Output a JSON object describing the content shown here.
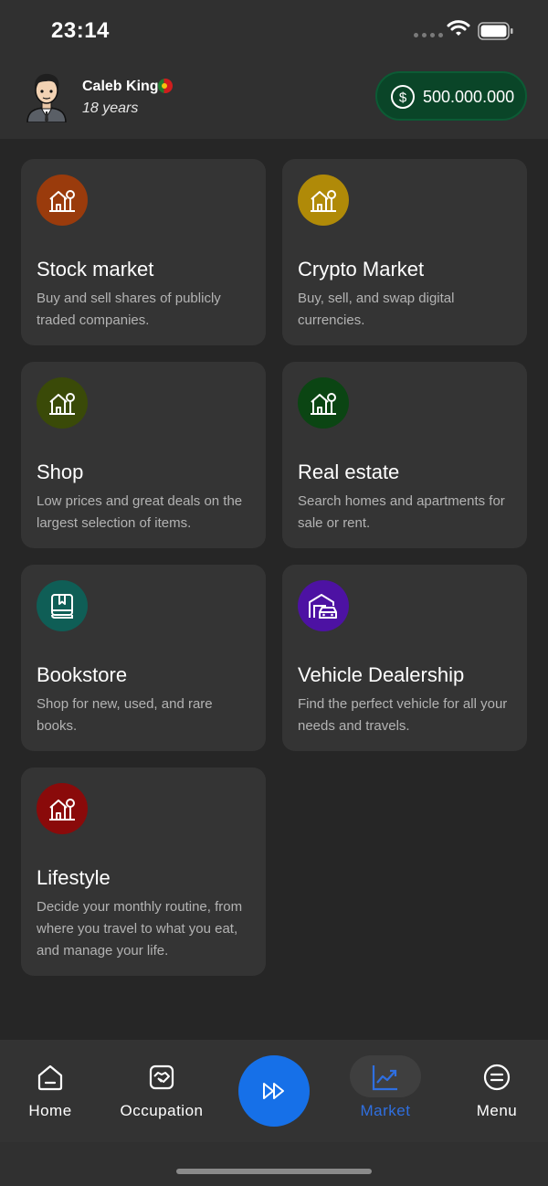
{
  "status_bar": {
    "time": "23:14",
    "icons": [
      "signal-dots-icon",
      "wifi-icon",
      "battery-icon"
    ]
  },
  "profile": {
    "name": "Caleb King",
    "age": "18 years",
    "flag": "portugal-flag-icon",
    "avatar": "avatar-icon"
  },
  "wallet": {
    "balance": "500.000.000",
    "icon": "dollar-coin-icon"
  },
  "cards": [
    {
      "title": "Stock market",
      "description": "Buy and sell shares of publicly traded companies.",
      "icon": "house-tree-icon",
      "color": "#9a3b0c"
    },
    {
      "title": "Crypto Market",
      "description": "Buy, sell, and swap digital currencies.",
      "icon": "house-tree-icon",
      "color": "#b08a08"
    },
    {
      "title": "Shop",
      "description": "Low prices and great deals on the largest selection of items.",
      "icon": "house-tree-icon",
      "color": "#3a4a08"
    },
    {
      "title": "Real estate",
      "description": "Search homes and apartments for sale or rent.",
      "icon": "house-tree-icon",
      "color": "#0b4513"
    },
    {
      "title": "Bookstore",
      "description": "Shop for new, used, and rare books.",
      "icon": "book-icon",
      "color": "#0f5e56"
    },
    {
      "title": "Vehicle Dealership",
      "description": "Find the perfect vehicle for all your needs and travels.",
      "icon": "garage-car-icon",
      "color": "#4d12a3"
    },
    {
      "title": "Lifestyle",
      "description": "Decide your monthly routine, from where you travel to what you eat, and manage your life.",
      "icon": "house-tree-icon",
      "color": "#8a0a0a"
    }
  ],
  "nav": {
    "items": [
      {
        "label": "Home",
        "icon": "home-icon"
      },
      {
        "label": "Occupation",
        "icon": "handshake-icon"
      },
      {
        "label": "Market",
        "icon": "chart-trend-icon",
        "active": true
      },
      {
        "label": "Menu",
        "icon": "menu-icon"
      }
    ],
    "fab_icon": "fast-forward-icon",
    "active_color": "#2f6fe0",
    "fab_color": "#1670e8"
  }
}
